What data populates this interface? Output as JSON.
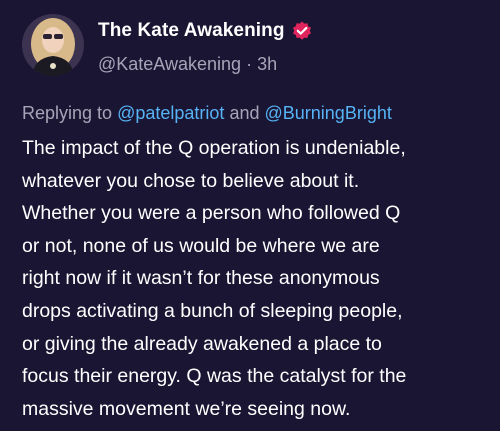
{
  "author": {
    "display_name": "The Kate Awakening",
    "handle": "@KateAwakening",
    "separator": "·",
    "time_ago": "3h",
    "verified_color": "#e0245e"
  },
  "reply": {
    "prefix": "Replying to",
    "mention_1": "@patelpatriot",
    "conjunction": "and",
    "mention_2": "@BurningBright"
  },
  "body_lines": [
    "The impact of the Q operation is undeniable,",
    "whatever you chose to believe about it.",
    "Whether you were a person who followed Q",
    "or not, none of us would be where we are",
    "right now if it wasn’t for these anonymous",
    "drops activating a bunch of sleeping people,",
    "or giving the already awakened a place to",
    "focus their energy. Q was the catalyst for the",
    "massive movement we’re seeing now."
  ],
  "colors": {
    "background": "#1a1533",
    "muted_text": "#a8a4b8",
    "link": "#56b3f5"
  }
}
